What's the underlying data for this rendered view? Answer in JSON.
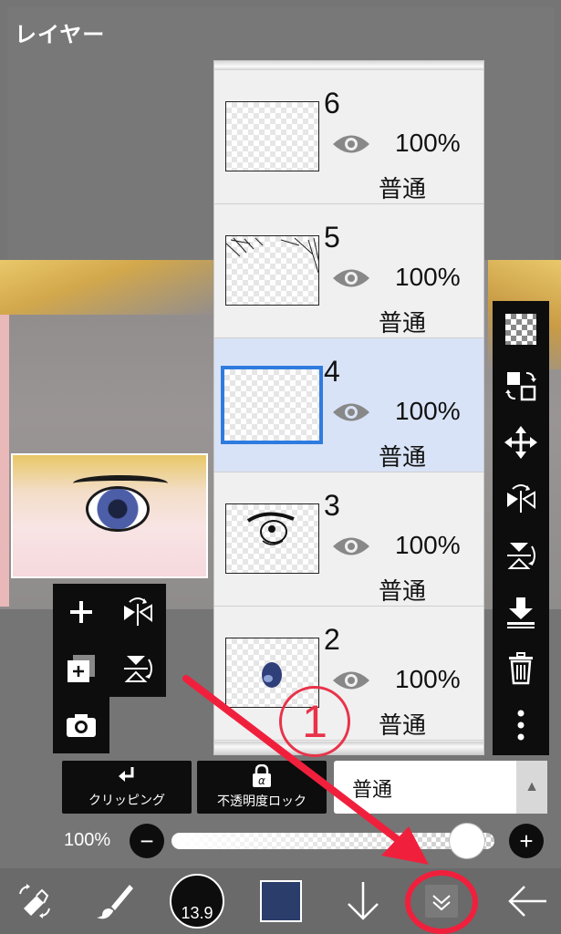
{
  "header": {
    "title": "レイヤー"
  },
  "layers": [
    {
      "number": "6",
      "opacity": "100%",
      "blend": "普通",
      "visible": true,
      "selected": false
    },
    {
      "number": "5",
      "opacity": "100%",
      "blend": "普通",
      "visible": true,
      "selected": false
    },
    {
      "number": "4",
      "opacity": "100%",
      "blend": "普通",
      "visible": true,
      "selected": true
    },
    {
      "number": "3",
      "opacity": "100%",
      "blend": "普通",
      "visible": true,
      "selected": false
    },
    {
      "number": "2",
      "opacity": "100%",
      "blend": "普通",
      "visible": true,
      "selected": false
    }
  ],
  "left_tools": [
    {
      "icon": "plus-icon"
    },
    {
      "icon": "flip-horizontal-icon"
    },
    {
      "icon": "copy-layer-icon"
    },
    {
      "icon": "flip-vertical-icon"
    },
    {
      "icon": "camera-icon"
    }
  ],
  "right_tools": [
    {
      "icon": "transparency-checker-icon"
    },
    {
      "icon": "swap-layer-icon"
    },
    {
      "icon": "move-icon"
    },
    {
      "icon": "flip-horizontal-icon"
    },
    {
      "icon": "flip-vertical-icon"
    },
    {
      "icon": "merge-down-icon"
    },
    {
      "icon": "trash-icon"
    },
    {
      "icon": "more-vertical-icon"
    }
  ],
  "controls": {
    "clipping_label": "クリッピング",
    "alpha_lock_label": "不透明度ロック",
    "blend_mode": "普通",
    "opacity_label": "100%",
    "opacity_value": 1.0,
    "minus": "−",
    "plus": "+"
  },
  "bottom_bar": {
    "brush_size": "13.9",
    "color": "#2a3d6b"
  },
  "annotation": {
    "number": "1"
  },
  "colors": {
    "selected_row": "#d9e3f7",
    "selection_border": "#2f7be0",
    "annotation_red": "#f0203d"
  }
}
